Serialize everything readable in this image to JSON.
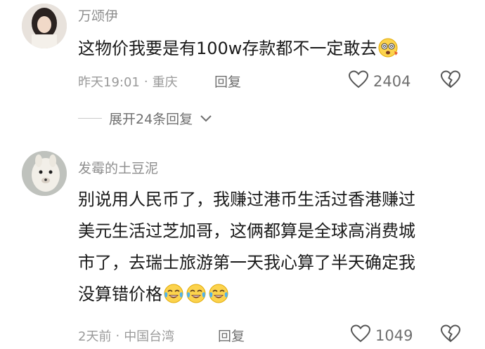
{
  "comments": [
    {
      "username": "万颂伊",
      "text": "这物价我要是有100w存款都不一定敢去",
      "time": "昨天19:01",
      "location": "重庆",
      "reply_label": "回复",
      "likes": "2404",
      "trailing_emoji": "dizzy-face-emoji",
      "expand_label": "展开24条回复"
    },
    {
      "username": "发霉的土豆泥",
      "lines": [
        "别说用人民币了，我赚过港币生活过香港赚过",
        "美元生活过芝加哥，这俩都算是全球高消费城",
        "市了，去瑞士旅游第一天我心算了半天确定我",
        "没算错价格"
      ],
      "trailing_emoji": "tears-of-joy-emoji",
      "time": "2天前",
      "location": "中国台湾",
      "reply_label": "回复",
      "likes": "1049"
    }
  ],
  "colors": {
    "text": "#1a1a1a",
    "meta": "#9a9a9a",
    "username": "#8e8e8e"
  }
}
